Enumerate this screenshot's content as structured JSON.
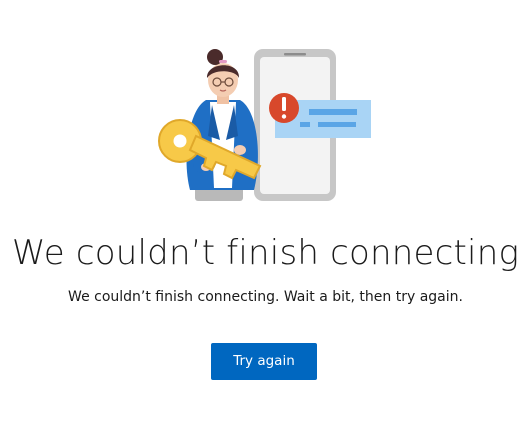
{
  "illustration": {
    "name": "person-holding-key-with-phone-error",
    "colors": {
      "key": "#f7c948",
      "key_outline": "#e0a82a",
      "jacket": "#1f6fc5",
      "phone_frame": "#c7c7c7",
      "phone_screen": "#f3f3f3",
      "error_badge": "#d8482b",
      "message_card": "#a9d4f5",
      "message_lines": "#5aa5e6",
      "hair": "#4a2b2b"
    }
  },
  "title": "We couldn’t finish connecting",
  "message": "We couldn’t finish connecting. Wait a bit, then try again.",
  "actions": {
    "retry_label": "Try again",
    "retry_color": "#0067c0"
  }
}
